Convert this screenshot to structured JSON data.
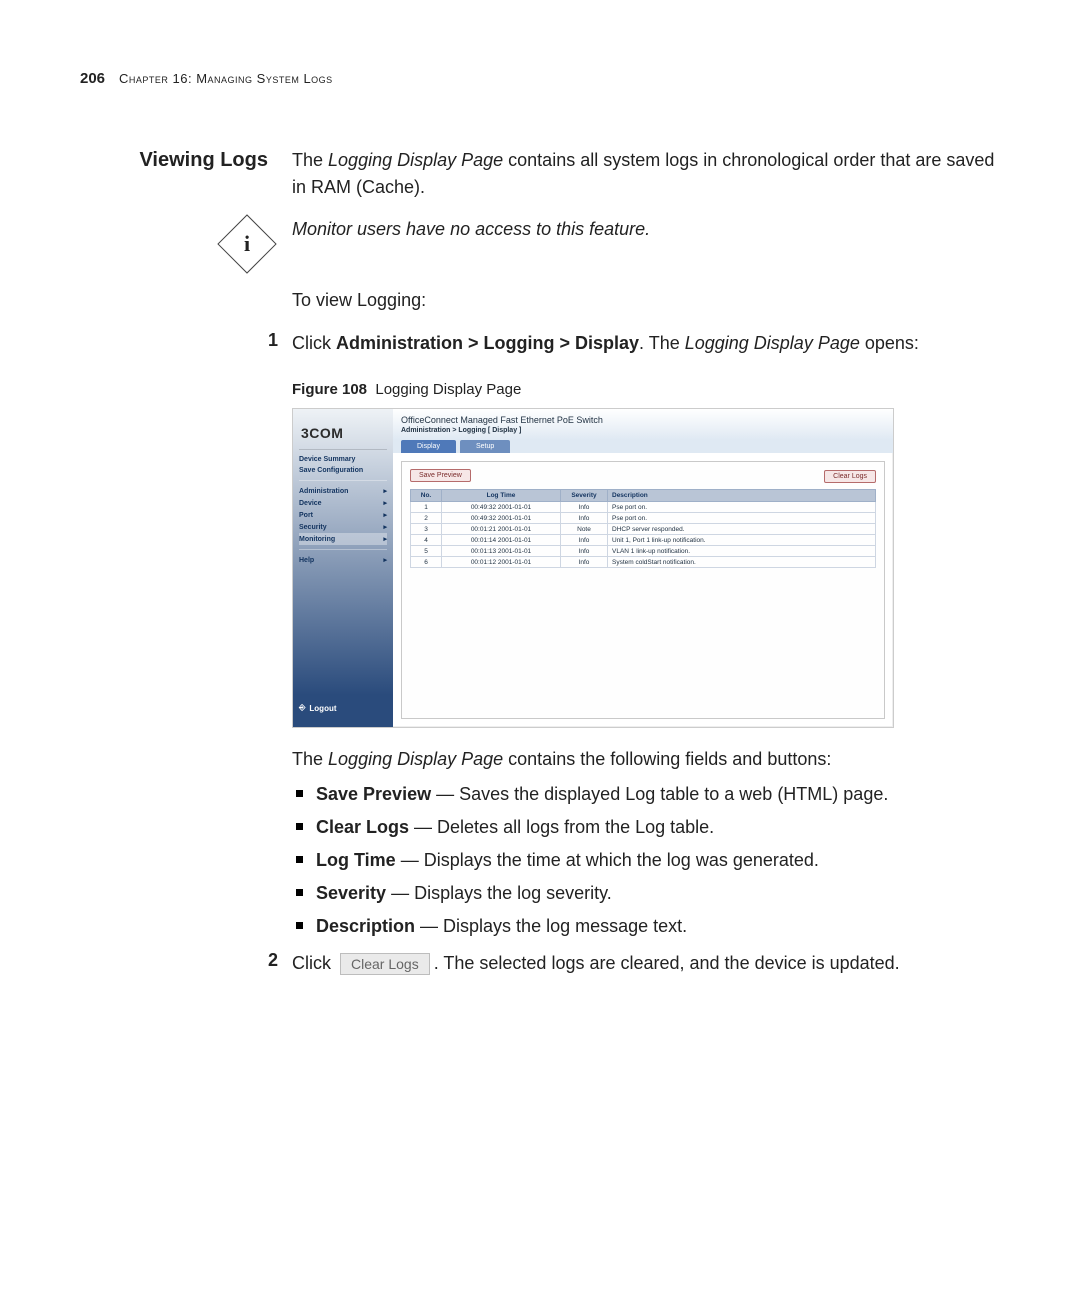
{
  "header": {
    "page_number": "206",
    "chapter": "Chapter 16: Managing System Logs"
  },
  "section_title": "Viewing Logs",
  "intro": {
    "prefix": "The ",
    "page_name": "Logging Display Page",
    "suffix": " contains all system logs in chronological order that are saved in RAM (Cache)."
  },
  "info_note": "Monitor users have no access to this feature.",
  "to_view": "To view Logging:",
  "step1": {
    "num": "1",
    "click": "Click ",
    "path": "Administration > Logging > Display",
    "after": ". The ",
    "page_name": "Logging Display Page",
    "opens": " opens:"
  },
  "figure": {
    "num": "Figure 108",
    "title": "Logging Display Page"
  },
  "screenshot": {
    "logo": "3COM",
    "product_title": "OfficeConnect Managed Fast Ethernet PoE Switch",
    "breadcrumb": "Administration > Logging [ Display ]",
    "side_links": {
      "summary": "Device Summary",
      "save_cfg": "Save Configuration"
    },
    "side_nav": [
      "Administration",
      "Device",
      "Port",
      "Security",
      "Monitoring",
      "Help"
    ],
    "logout": "Logout",
    "tabs": {
      "display": "Display",
      "setup": "Setup"
    },
    "buttons": {
      "save_preview": "Save Preview",
      "clear_logs": "Clear Logs"
    },
    "table": {
      "headers": {
        "no": "No.",
        "time": "Log Time",
        "sev": "Severity",
        "desc": "Description"
      },
      "rows": [
        {
          "no": "1",
          "time": "00:49:32 2001-01-01",
          "sev": "Info",
          "desc": "Pse port on."
        },
        {
          "no": "2",
          "time": "00:49:32 2001-01-01",
          "sev": "Info",
          "desc": "Pse port on."
        },
        {
          "no": "3",
          "time": "00:01:21 2001-01-01",
          "sev": "Note",
          "desc": "DHCP server responded."
        },
        {
          "no": "4",
          "time": "00:01:14 2001-01-01",
          "sev": "Info",
          "desc": "Unit 1, Port 1 link-up notification."
        },
        {
          "no": "5",
          "time": "00:01:13 2001-01-01",
          "sev": "Info",
          "desc": "VLAN 1 link-up notification."
        },
        {
          "no": "6",
          "time": "00:01:12 2001-01-01",
          "sev": "Info",
          "desc": "System coldStart notification."
        }
      ]
    }
  },
  "fields_intro": {
    "prefix": "The ",
    "page_name": "Logging Display Page",
    "suffix": " contains the following fields and buttons:"
  },
  "bullets": [
    {
      "term": "Save Preview",
      "desc": " — Saves the displayed Log table to a web (HTML) page."
    },
    {
      "term": "Clear Logs",
      "desc": " — Deletes all logs from the Log table."
    },
    {
      "term": "Log Time",
      "desc": " — Displays the time at which the log was generated."
    },
    {
      "term": "Severity",
      "desc": " — Displays the log severity."
    },
    {
      "term": "Description",
      "desc": " — Displays the log message text."
    }
  ],
  "step2": {
    "num": "2",
    "click": "Click ",
    "button": "Clear Logs",
    "after": ". The selected logs are cleared, and the device is updated."
  }
}
